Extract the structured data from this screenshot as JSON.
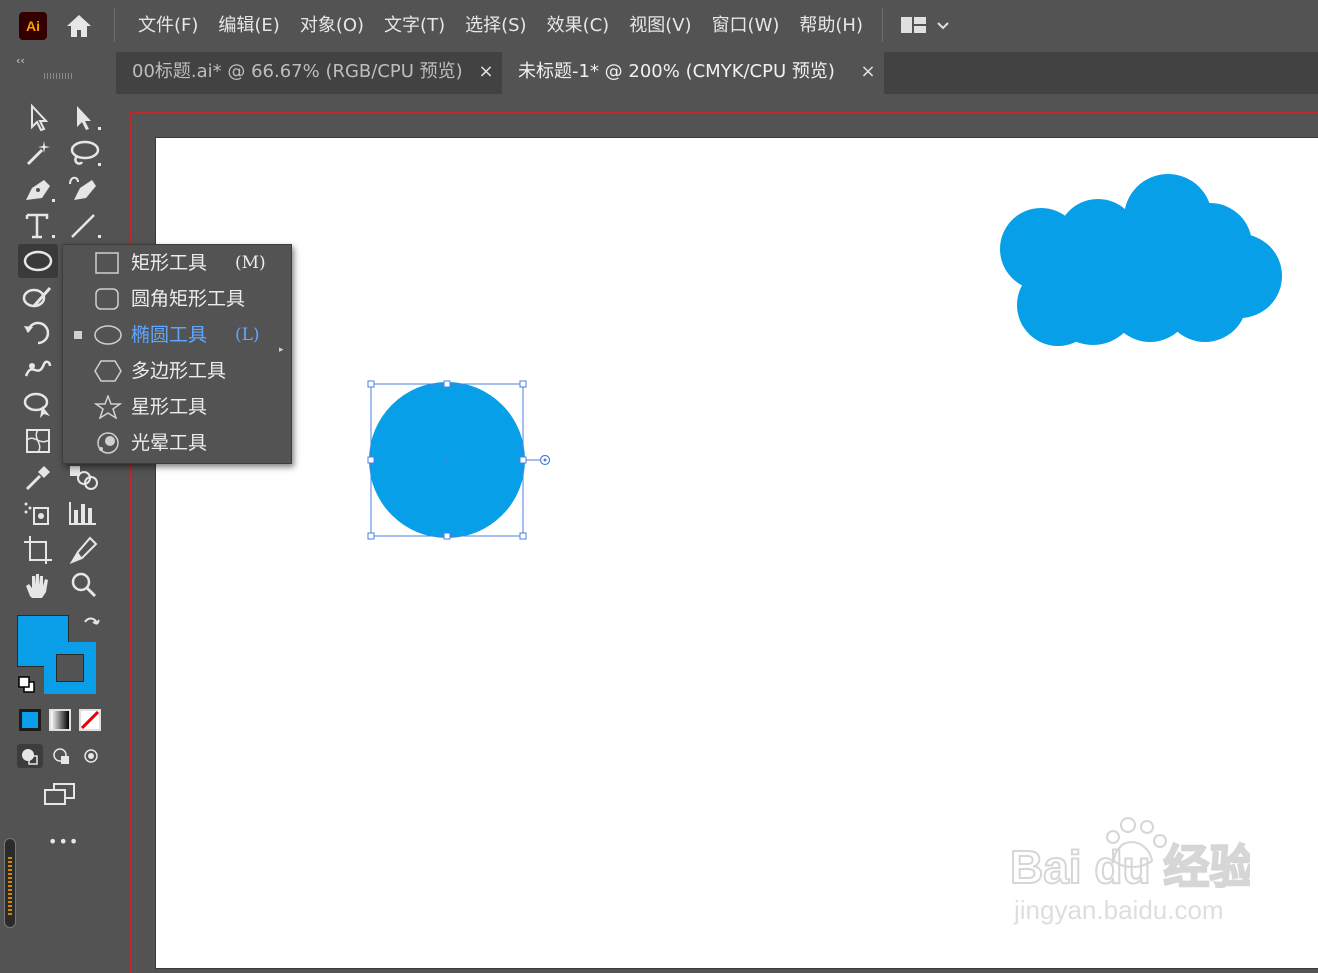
{
  "app": {
    "logo_text": "Ai",
    "accent": "#ff9a00"
  },
  "menu": [
    "文件(F)",
    "编辑(E)",
    "对象(O)",
    "文字(T)",
    "选择(S)",
    "效果(C)",
    "视图(V)",
    "窗口(W)",
    "帮助(H)"
  ],
  "tabs": [
    {
      "label": "00标题.ai* @ 66.67% (RGB/CPU 预览)",
      "close": "×",
      "active": false
    },
    {
      "label": "未标题-1* @ 200% (CMYK/CPU 预览)",
      "close": "×",
      "active": true
    }
  ],
  "toolbar": {
    "collapse_icon": "‹‹",
    "more": "•••"
  },
  "flyout": {
    "items": [
      {
        "label": "矩形工具",
        "key": "(M)",
        "icon": "rectangle-icon",
        "selected": false
      },
      {
        "label": "圆角矩形工具",
        "key": "",
        "icon": "rounded-rectangle-icon",
        "selected": false
      },
      {
        "label": "椭圆工具",
        "key": "(L)",
        "icon": "ellipse-icon",
        "selected": true
      },
      {
        "label": "多边形工具",
        "key": "",
        "icon": "polygon-icon",
        "selected": false
      },
      {
        "label": "星形工具",
        "key": "",
        "icon": "star-icon",
        "selected": false
      },
      {
        "label": "光晕工具",
        "key": "",
        "icon": "flare-icon",
        "selected": false
      }
    ]
  },
  "colors": {
    "fill": "#0b9ee8",
    "shape": "#079fe8",
    "selection": "#4a7fe0",
    "bleed": "#c02a2a"
  },
  "watermark": {
    "brand": "Bai du 经验",
    "url": "jingyan.baidu.com"
  }
}
